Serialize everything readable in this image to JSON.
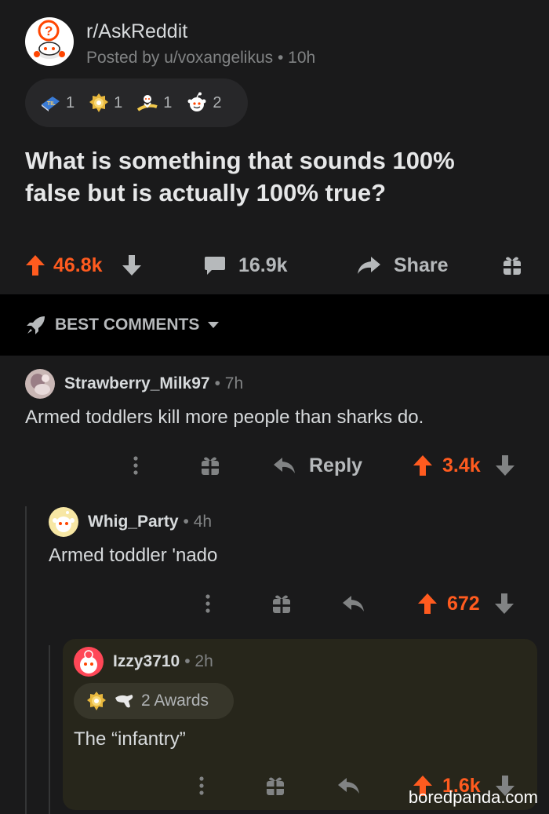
{
  "post": {
    "subreddit": "r/AskReddit",
    "posted_by": "Posted by u/voxangelikus • 10h",
    "awards": [
      {
        "icon": "book-award-icon",
        "count": "1"
      },
      {
        "icon": "gold-award-icon",
        "count": "1"
      },
      {
        "icon": "snoo-surf-award-icon",
        "count": "1"
      },
      {
        "icon": "snoo-award-icon",
        "count": "2"
      }
    ],
    "title": "What is something that sounds 100% false but is actually 100% true?",
    "upvotes": "46.8k",
    "comments": "16.9k",
    "share_label": "Share"
  },
  "section": {
    "label": "BEST COMMENTS"
  },
  "comments": [
    {
      "username": "Strawberry_Milk97",
      "time": "• 7h",
      "body": "Armed toddlers kill more people than sharks do.",
      "reply_label": "Reply",
      "upvotes": "3.4k"
    },
    {
      "username": "Whig_Party",
      "time": "• 4h",
      "body": "Armed toddler 'nado",
      "upvotes": "672"
    },
    {
      "username": "Izzy3710",
      "time": "• 2h",
      "awards_label": "2 Awards",
      "body": "The “infantry”",
      "upvotes": "1.6k"
    }
  ],
  "watermark": "boredpanda.com",
  "colors": {
    "background": "#1a1a1b",
    "upvote_orange": "#ff5b1f",
    "muted_text": "#818384",
    "highlight_comment_bg": "#27261b"
  }
}
